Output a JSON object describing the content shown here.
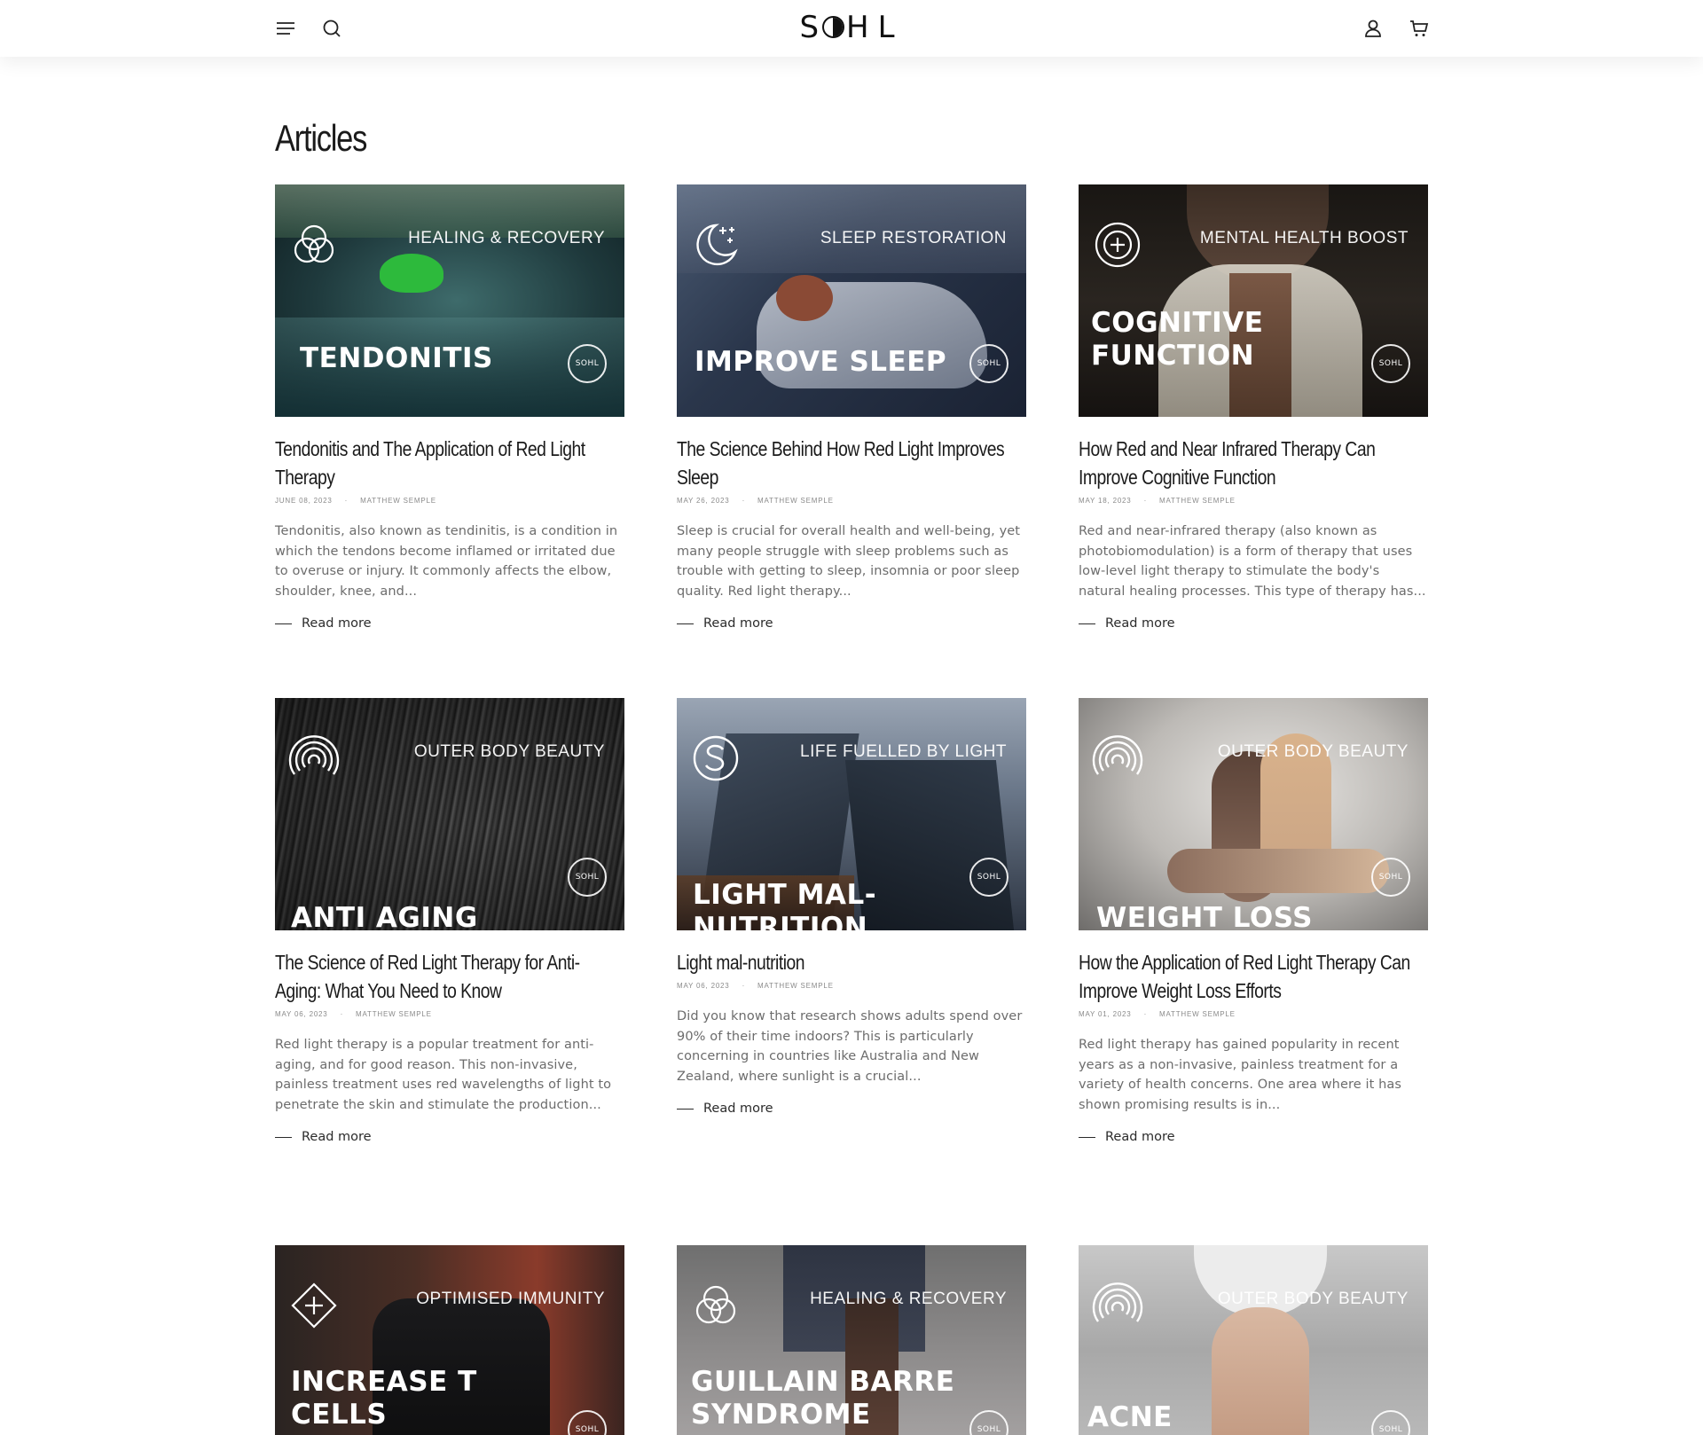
{
  "header": {
    "brand": "SOHL",
    "brand_start": "S",
    "brand_end": "HL"
  },
  "page": {
    "title": "Articles"
  },
  "read_more_label": "Read more",
  "articles": [
    {
      "tag": "HEALING & RECOVERY",
      "overlay": "TENDONITIS",
      "badge": "SOHL",
      "title": "Tendonitis and The Application of Red Light Therapy",
      "date": "JUNE 08, 2023",
      "author": "MATTHEW SEMPLE",
      "excerpt": "  Tendonitis, also known as tendinitis, is a condition in which the tendons become inflamed or irritated due to overuse or injury. It commonly affects the elbow, shoulder, knee, and...",
      "icon": "venn-icon"
    },
    {
      "tag": "SLEEP RESTORATION",
      "overlay": "IMPROVE SLEEP",
      "badge": "SOHL",
      "title": "The Science Behind How Red Light Improves Sleep",
      "date": "MAY 26, 2023",
      "author": "MATTHEW SEMPLE",
      "excerpt": "Sleep is crucial for overall health and well-being, yet many people struggle with sleep problems such as trouble with getting to sleep, insomnia or poor sleep quality. Red light therapy...",
      "icon": "moon-icon"
    },
    {
      "tag": "MENTAL HEALTH BOOST",
      "overlay": "COGNITIVE FUNCTION",
      "badge": "SOHL",
      "title": "How Red and Near Infrared Therapy Can Improve Cognitive Function",
      "date": "MAY 18, 2023",
      "author": "MATTHEW SEMPLE",
      "excerpt": "Red and near-infrared therapy (also known as photobiomodulation) is a form of therapy that uses low-level light therapy to stimulate the body's natural healing processes. This type of therapy has...",
      "icon": "plus-circle-icon"
    },
    {
      "tag": "OUTER BODY BEAUTY",
      "overlay": "ANTI AGING",
      "badge": "SOHL",
      "title": "The Science of Red Light Therapy for Anti-Aging: What You Need to Know",
      "date": "MAY 06, 2023",
      "author": "MATTHEW SEMPLE",
      "excerpt": "Red light therapy is a popular treatment for anti-aging, and for good reason. This non-invasive, painless treatment uses red wavelengths of light to penetrate the skin and stimulate the production...",
      "icon": "radiate-icon"
    },
    {
      "tag": "LIFE FUELLED BY LIGHT",
      "overlay": "LIGHT MAL-NUTRITION",
      "badge": "SOHL",
      "title": "Light mal-nutrition",
      "date": "MAY 06, 2023",
      "author": "MATTHEW SEMPLE",
      "excerpt": "Did you know that research shows adults spend over 90% of their time indoors? This is particularly concerning in countries like Australia and New Zealand, where sunlight is a crucial...",
      "icon": "s-logo-icon"
    },
    {
      "tag": "OUTER BODY BEAUTY",
      "overlay": "WEIGHT LOSS",
      "badge": "SOHL",
      "title": "How the Application of Red Light Therapy Can Improve Weight Loss Efforts",
      "date": "MAY 01, 2023",
      "author": "MATTHEW SEMPLE",
      "excerpt": "Red light therapy has gained popularity in recent years as a non-invasive, painless treatment for a variety of health concerns. One area where it has shown promising results is in...",
      "icon": "radiate-icon"
    },
    {
      "tag": "OPTIMISED IMMUNITY",
      "overlay": "INCREASE T CELLS",
      "badge": "SOHL",
      "icon": "diamond-plus-icon"
    },
    {
      "tag": "HEALING & RECOVERY",
      "overlay": "GUILLAIN BARRE SYNDROME",
      "badge": "SOHL",
      "icon": "venn-icon"
    },
    {
      "tag": "OUTER BODY BEAUTY",
      "overlay": "ACNE",
      "badge": "SOHL",
      "icon": "radiate-icon"
    }
  ]
}
